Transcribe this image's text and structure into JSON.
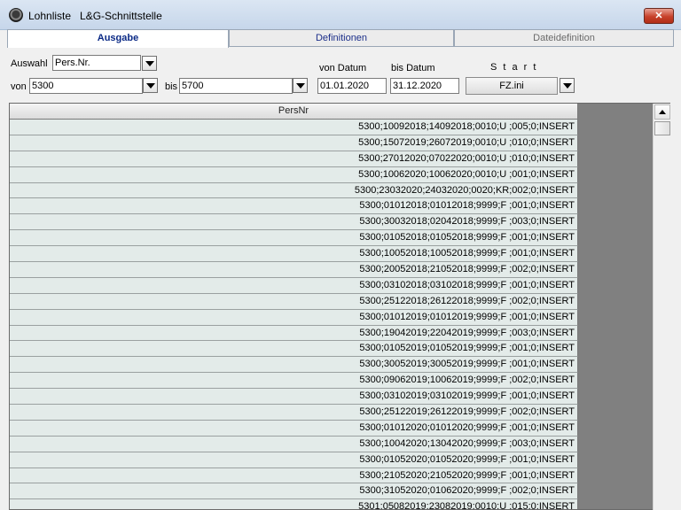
{
  "window": {
    "title": "Lohnliste   L&G-Schnittstelle",
    "close_label": "✕"
  },
  "tabs": [
    {
      "label": "Ausgabe",
      "active": true
    },
    {
      "label": "Definitionen",
      "active": false
    },
    {
      "label": "Dateidefinition",
      "active": false
    }
  ],
  "filters": {
    "auswahl_label": "Auswahl",
    "auswahl_value": "Pers.Nr.",
    "von_label": "von",
    "von_value": "5300",
    "bis_label": "bis",
    "bis_value": "5700",
    "von_datum_label": "von Datum",
    "von_datum_value": "01.01.2020",
    "bis_datum_label": "bis Datum",
    "bis_datum_value": "31.12.2020",
    "start_label": "S t a r t",
    "ini_value": "FZ.ini"
  },
  "grid": {
    "header": "PersNr",
    "rows": [
      "5300;10092018;14092018;0010;U ;005;0;INSERT",
      "5300;15072019;26072019;0010;U ;010;0;INSERT",
      "5300;27012020;07022020;0010;U ;010;0;INSERT",
      "5300;10062020;10062020;0010;U ;001;0;INSERT",
      "5300;23032020;24032020;0020;KR;002;0;INSERT",
      "5300;01012018;01012018;9999;F ;001;0;INSERT",
      "5300;30032018;02042018;9999;F ;003;0;INSERT",
      "5300;01052018;01052018;9999;F ;001;0;INSERT",
      "5300;10052018;10052018;9999;F ;001;0;INSERT",
      "5300;20052018;21052018;9999;F ;002;0;INSERT",
      "5300;03102018;03102018;9999;F ;001;0;INSERT",
      "5300;25122018;26122018;9999;F ;002;0;INSERT",
      "5300;01012019;01012019;9999;F ;001;0;INSERT",
      "5300;19042019;22042019;9999;F ;003;0;INSERT",
      "5300;01052019;01052019;9999;F ;001;0;INSERT",
      "5300;30052019;30052019;9999;F ;001;0;INSERT",
      "5300;09062019;10062019;9999;F ;002;0;INSERT",
      "5300;03102019;03102019;9999;F ;001;0;INSERT",
      "5300;25122019;26122019;9999;F ;002;0;INSERT",
      "5300;01012020;01012020;9999;F ;001;0;INSERT",
      "5300;10042020;13042020;9999;F ;003;0;INSERT",
      "5300;01052020;01052020;9999;F ;001;0;INSERT",
      "5300;21052020;21052020;9999;F ;001;0;INSERT",
      "5300;31052020;01062020;9999;F ;002;0;INSERT",
      "5301;05082019;23082019;0010;U ;015;0;INSERT"
    ]
  }
}
